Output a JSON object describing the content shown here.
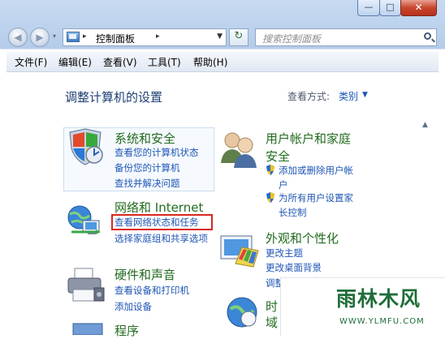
{
  "window": {
    "min_glyph": "—",
    "max_glyph": "□",
    "close_glyph": "✕"
  },
  "nav": {
    "back_glyph": "◀",
    "forward_glyph": "▶",
    "history_glyph": "▾",
    "breadcrumb_sep": "▸",
    "address": "控制面板",
    "address_sep": "▸",
    "address_dropdown_glyph": "▼",
    "refresh_glyph": "↻",
    "search_placeholder": "搜索控制面板"
  },
  "menubar": {
    "items": [
      "文件(F)",
      "编辑(E)",
      "查看(V)",
      "工具(T)",
      "帮助(H)"
    ]
  },
  "content": {
    "heading": "调整计算机的设置",
    "view_by_label": "查看方式:",
    "view_by_value": "类别",
    "view_caret": "▼",
    "scroll_up_glyph": "▲",
    "categories": [
      {
        "title": "系统和安全",
        "tasks": [
          "查看您的计算机状态",
          "备份您的计算机",
          "查找并解决问题"
        ]
      },
      {
        "title": "网络和 Internet",
        "tasks": [
          "查看网络状态和任务",
          "选择家庭组和共享选项"
        ]
      },
      {
        "title": "硬件和声音",
        "tasks": [
          "查看设备和打印机",
          "添加设备"
        ]
      },
      {
        "title_line1": "用户帐户和家庭",
        "title_line2": "安全",
        "tasks": [
          "添加或删除用户帐",
          "户",
          "为所有用户设置家",
          "长控制"
        ]
      },
      {
        "title": "外观和个性化",
        "tasks": [
          "更改主题",
          "更改桌面背景",
          "调整屏幕分辨率"
        ]
      },
      {
        "title_partial": "时",
        "title_partial2": "域"
      },
      {
        "title_partial": "程序"
      }
    ]
  },
  "watermark": {
    "title": "雨林木风",
    "url": "WWW.YLMFU.COM"
  },
  "colors": {
    "category_title": "#226b1f",
    "task_link": "#1f56b5",
    "highlight": "#d9271d"
  }
}
